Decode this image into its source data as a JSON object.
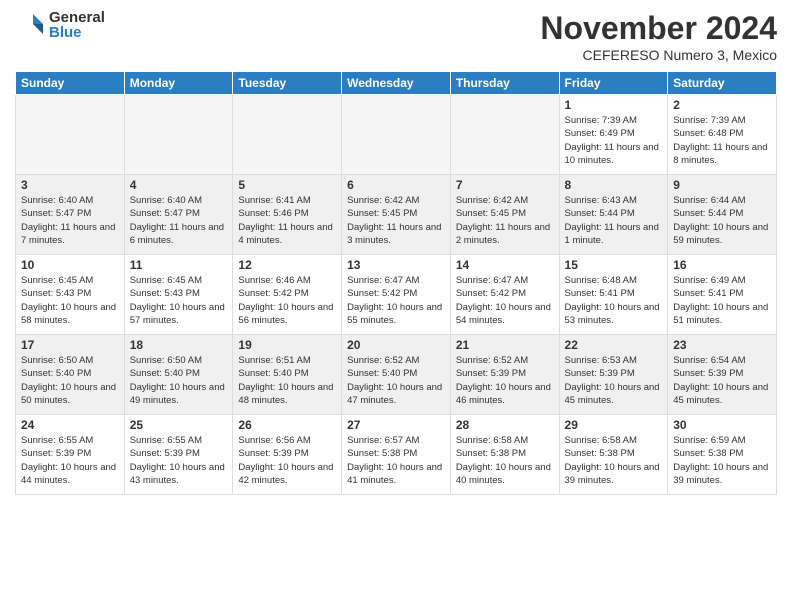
{
  "logo": {
    "general": "General",
    "blue": "Blue"
  },
  "title": "November 2024",
  "location": "CEFERESO Numero 3, Mexico",
  "weekdays": [
    "Sunday",
    "Monday",
    "Tuesday",
    "Wednesday",
    "Thursday",
    "Friday",
    "Saturday"
  ],
  "weeks": [
    [
      {
        "day": "",
        "info": ""
      },
      {
        "day": "",
        "info": ""
      },
      {
        "day": "",
        "info": ""
      },
      {
        "day": "",
        "info": ""
      },
      {
        "day": "",
        "info": ""
      },
      {
        "day": "1",
        "info": "Sunrise: 7:39 AM\nSunset: 6:49 PM\nDaylight: 11 hours and 10 minutes."
      },
      {
        "day": "2",
        "info": "Sunrise: 7:39 AM\nSunset: 6:48 PM\nDaylight: 11 hours and 8 minutes."
      }
    ],
    [
      {
        "day": "3",
        "info": "Sunrise: 6:40 AM\nSunset: 5:47 PM\nDaylight: 11 hours and 7 minutes."
      },
      {
        "day": "4",
        "info": "Sunrise: 6:40 AM\nSunset: 5:47 PM\nDaylight: 11 hours and 6 minutes."
      },
      {
        "day": "5",
        "info": "Sunrise: 6:41 AM\nSunset: 5:46 PM\nDaylight: 11 hours and 4 minutes."
      },
      {
        "day": "6",
        "info": "Sunrise: 6:42 AM\nSunset: 5:45 PM\nDaylight: 11 hours and 3 minutes."
      },
      {
        "day": "7",
        "info": "Sunrise: 6:42 AM\nSunset: 5:45 PM\nDaylight: 11 hours and 2 minutes."
      },
      {
        "day": "8",
        "info": "Sunrise: 6:43 AM\nSunset: 5:44 PM\nDaylight: 11 hours and 1 minute."
      },
      {
        "day": "9",
        "info": "Sunrise: 6:44 AM\nSunset: 5:44 PM\nDaylight: 10 hours and 59 minutes."
      }
    ],
    [
      {
        "day": "10",
        "info": "Sunrise: 6:45 AM\nSunset: 5:43 PM\nDaylight: 10 hours and 58 minutes."
      },
      {
        "day": "11",
        "info": "Sunrise: 6:45 AM\nSunset: 5:43 PM\nDaylight: 10 hours and 57 minutes."
      },
      {
        "day": "12",
        "info": "Sunrise: 6:46 AM\nSunset: 5:42 PM\nDaylight: 10 hours and 56 minutes."
      },
      {
        "day": "13",
        "info": "Sunrise: 6:47 AM\nSunset: 5:42 PM\nDaylight: 10 hours and 55 minutes."
      },
      {
        "day": "14",
        "info": "Sunrise: 6:47 AM\nSunset: 5:42 PM\nDaylight: 10 hours and 54 minutes."
      },
      {
        "day": "15",
        "info": "Sunrise: 6:48 AM\nSunset: 5:41 PM\nDaylight: 10 hours and 53 minutes."
      },
      {
        "day": "16",
        "info": "Sunrise: 6:49 AM\nSunset: 5:41 PM\nDaylight: 10 hours and 51 minutes."
      }
    ],
    [
      {
        "day": "17",
        "info": "Sunrise: 6:50 AM\nSunset: 5:40 PM\nDaylight: 10 hours and 50 minutes."
      },
      {
        "day": "18",
        "info": "Sunrise: 6:50 AM\nSunset: 5:40 PM\nDaylight: 10 hours and 49 minutes."
      },
      {
        "day": "19",
        "info": "Sunrise: 6:51 AM\nSunset: 5:40 PM\nDaylight: 10 hours and 48 minutes."
      },
      {
        "day": "20",
        "info": "Sunrise: 6:52 AM\nSunset: 5:40 PM\nDaylight: 10 hours and 47 minutes."
      },
      {
        "day": "21",
        "info": "Sunrise: 6:52 AM\nSunset: 5:39 PM\nDaylight: 10 hours and 46 minutes."
      },
      {
        "day": "22",
        "info": "Sunrise: 6:53 AM\nSunset: 5:39 PM\nDaylight: 10 hours and 45 minutes."
      },
      {
        "day": "23",
        "info": "Sunrise: 6:54 AM\nSunset: 5:39 PM\nDaylight: 10 hours and 45 minutes."
      }
    ],
    [
      {
        "day": "24",
        "info": "Sunrise: 6:55 AM\nSunset: 5:39 PM\nDaylight: 10 hours and 44 minutes."
      },
      {
        "day": "25",
        "info": "Sunrise: 6:55 AM\nSunset: 5:39 PM\nDaylight: 10 hours and 43 minutes."
      },
      {
        "day": "26",
        "info": "Sunrise: 6:56 AM\nSunset: 5:39 PM\nDaylight: 10 hours and 42 minutes."
      },
      {
        "day": "27",
        "info": "Sunrise: 6:57 AM\nSunset: 5:38 PM\nDaylight: 10 hours and 41 minutes."
      },
      {
        "day": "28",
        "info": "Sunrise: 6:58 AM\nSunset: 5:38 PM\nDaylight: 10 hours and 40 minutes."
      },
      {
        "day": "29",
        "info": "Sunrise: 6:58 AM\nSunset: 5:38 PM\nDaylight: 10 hours and 39 minutes."
      },
      {
        "day": "30",
        "info": "Sunrise: 6:59 AM\nSunset: 5:38 PM\nDaylight: 10 hours and 39 minutes."
      }
    ]
  ]
}
